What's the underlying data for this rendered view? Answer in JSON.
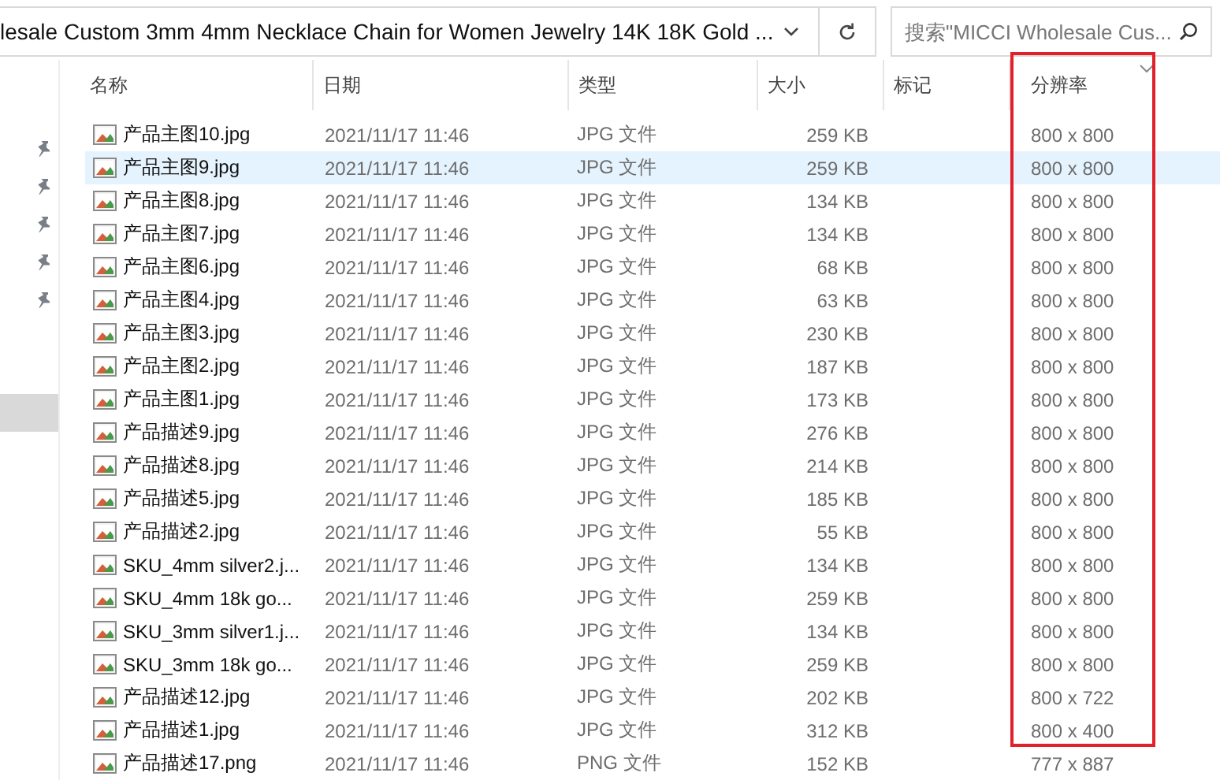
{
  "address_bar": {
    "path": "lesale Custom 3mm 4mm Necklace Chain for Women Jewelry 14K 18K Gold ..."
  },
  "search": {
    "placeholder": "搜索\"MICCI Wholesale Cus..."
  },
  "sidebar": {
    "items": [
      {
        "pinned": true,
        "selected": false
      },
      {
        "pinned": true,
        "selected": false
      },
      {
        "pinned": true,
        "selected": false
      },
      {
        "pinned": true,
        "selected": false
      },
      {
        "pinned": true,
        "selected": false
      },
      {
        "pinned": false,
        "selected": true
      }
    ]
  },
  "file_list": {
    "columns": [
      {
        "label": "名称",
        "sorted": false,
        "boxed": false
      },
      {
        "label": "日期",
        "sorted": false,
        "boxed": false
      },
      {
        "label": "类型",
        "sorted": false,
        "boxed": false
      },
      {
        "label": "大小",
        "sorted": false,
        "boxed": false
      },
      {
        "label": "标记",
        "sorted": false,
        "boxed": false
      },
      {
        "label": "分辨率",
        "sorted": true,
        "boxed": true
      }
    ],
    "rows": [
      {
        "name": "产品主图10.jpg",
        "date": "2021/11/17 11:46",
        "type": "JPG 文件",
        "size": "259 KB",
        "resolution": "800 x 800",
        "selected": false,
        "boxed": true
      },
      {
        "name": "产品主图9.jpg",
        "date": "2021/11/17 11:46",
        "type": "JPG 文件",
        "size": "259 KB",
        "resolution": "800 x 800",
        "selected": true,
        "boxed": true
      },
      {
        "name": "产品主图8.jpg",
        "date": "2021/11/17 11:46",
        "type": "JPG 文件",
        "size": "134 KB",
        "resolution": "800 x 800",
        "selected": false,
        "boxed": true
      },
      {
        "name": "产品主图7.jpg",
        "date": "2021/11/17 11:46",
        "type": "JPG 文件",
        "size": "134 KB",
        "resolution": "800 x 800",
        "selected": false,
        "boxed": true
      },
      {
        "name": "产品主图6.jpg",
        "date": "2021/11/17 11:46",
        "type": "JPG 文件",
        "size": "68 KB",
        "resolution": "800 x 800",
        "selected": false,
        "boxed": true
      },
      {
        "name": "产品主图4.jpg",
        "date": "2021/11/17 11:46",
        "type": "JPG 文件",
        "size": "63 KB",
        "resolution": "800 x 800",
        "selected": false,
        "boxed": true
      },
      {
        "name": "产品主图3.jpg",
        "date": "2021/11/17 11:46",
        "type": "JPG 文件",
        "size": "230 KB",
        "resolution": "800 x 800",
        "selected": false,
        "boxed": true
      },
      {
        "name": "产品主图2.jpg",
        "date": "2021/11/17 11:46",
        "type": "JPG 文件",
        "size": "187 KB",
        "resolution": "800 x 800",
        "selected": false,
        "boxed": true
      },
      {
        "name": "产品主图1.jpg",
        "date": "2021/11/17 11:46",
        "type": "JPG 文件",
        "size": "173 KB",
        "resolution": "800 x 800",
        "selected": false,
        "boxed": true
      },
      {
        "name": "产品描述9.jpg",
        "date": "2021/11/17 11:46",
        "type": "JPG 文件",
        "size": "276 KB",
        "resolution": "800 x 800",
        "selected": false,
        "boxed": true
      },
      {
        "name": "产品描述8.jpg",
        "date": "2021/11/17 11:46",
        "type": "JPG 文件",
        "size": "214 KB",
        "resolution": "800 x 800",
        "selected": false,
        "boxed": true
      },
      {
        "name": "产品描述5.jpg",
        "date": "2021/11/17 11:46",
        "type": "JPG 文件",
        "size": "185 KB",
        "resolution": "800 x 800",
        "selected": false,
        "boxed": true
      },
      {
        "name": "产品描述2.jpg",
        "date": "2021/11/17 11:46",
        "type": "JPG 文件",
        "size": "55 KB",
        "resolution": "800 x 800",
        "selected": false,
        "boxed": true
      },
      {
        "name": "SKU_4mm silver2.j...",
        "date": "2021/11/17 11:46",
        "type": "JPG 文件",
        "size": "134 KB",
        "resolution": "800 x 800",
        "selected": false,
        "boxed": true
      },
      {
        "name": "SKU_4mm 18k go...",
        "date": "2021/11/17 11:46",
        "type": "JPG 文件",
        "size": "259 KB",
        "resolution": "800 x 800",
        "selected": false,
        "boxed": true
      },
      {
        "name": "SKU_3mm silver1.j...",
        "date": "2021/11/17 11:46",
        "type": "JPG 文件",
        "size": "134 KB",
        "resolution": "800 x 800",
        "selected": false,
        "boxed": true
      },
      {
        "name": "SKU_3mm 18k go...",
        "date": "2021/11/17 11:46",
        "type": "JPG 文件",
        "size": "259 KB",
        "resolution": "800 x 800",
        "selected": false,
        "boxed": true
      },
      {
        "name": "产品描述12.jpg",
        "date": "2021/11/17 11:46",
        "type": "JPG 文件",
        "size": "202 KB",
        "resolution": "800 x 722",
        "selected": false,
        "boxed": true
      },
      {
        "name": "产品描述1.jpg",
        "date": "2021/11/17 11:46",
        "type": "JPG 文件",
        "size": "312 KB",
        "resolution": "800 x 400",
        "selected": false,
        "boxed": true
      },
      {
        "name": "产品描述17.png",
        "date": "2021/11/17 11:46",
        "type": "PNG 文件",
        "size": "152 KB",
        "resolution": "777 x 887",
        "selected": false,
        "boxed": false
      }
    ]
  }
}
